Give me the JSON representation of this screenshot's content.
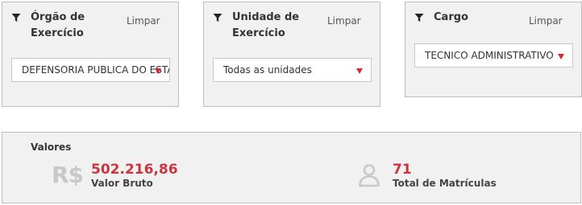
{
  "filters": [
    {
      "title_line1": "Órgão de",
      "title_line2": "Exercício",
      "clear_label": "Limpar",
      "selected_value": "DEFENSORIA PUBLICA DO ESTADO",
      "icon": "filter-icon"
    },
    {
      "title_line1": "Unidade de",
      "title_line2": "Exercício",
      "clear_label": "Limpar",
      "selected_value": "Todas as unidades",
      "icon": "filter-icon"
    },
    {
      "title_line1": "Cargo",
      "title_line2": "",
      "clear_label": "Limpar",
      "selected_value": "TECNICO ADMINISTRATIVO",
      "icon": "filter-icon"
    }
  ],
  "summary": {
    "title": "Valores",
    "gross_value": {
      "icon_text": "R$",
      "value": "502.216,86",
      "label": "Valor Bruto"
    },
    "registrations": {
      "icon": "person-icon",
      "value": "71",
      "label": "Total de Matrículas"
    }
  },
  "colors": {
    "accent": "#c9363d",
    "panel_bg": "#f1f1f1",
    "panel_border": "#bdbdbd",
    "icon_gray": "#c8c8c8"
  }
}
